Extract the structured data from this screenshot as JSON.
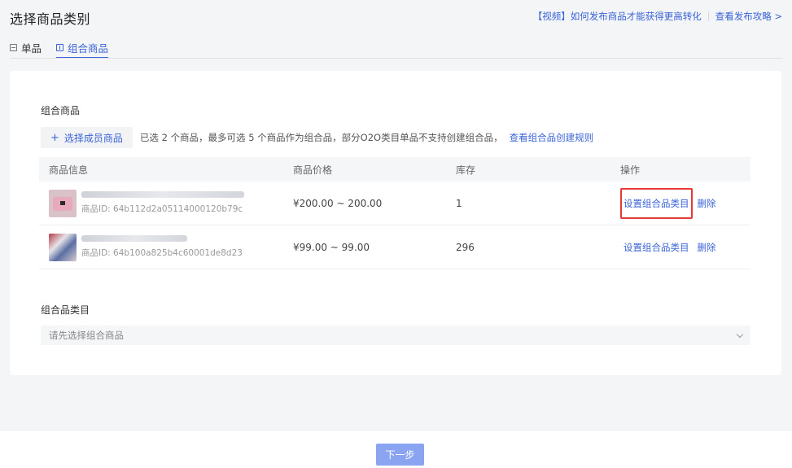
{
  "header": {
    "title": "选择商品类别",
    "link_video": "【视频】如何发布商品才能获得更高转化",
    "link_guide": "查看发布攻略 >",
    "tabs": [
      {
        "label": "单品",
        "active": false
      },
      {
        "label": "组合商品",
        "active": true
      }
    ]
  },
  "combo": {
    "section_title": "组合商品",
    "add_button": "选择成员商品",
    "hint": "已选 2 个商品，最多可选 5 个商品作为组合品，部分O2O类目单品不支持创建组合品，",
    "rule_link": "查看组合品创建规则",
    "table": {
      "headers": [
        "商品信息",
        "商品价格",
        "库存",
        "操作"
      ],
      "rows": [
        {
          "pid": "商品ID: 64b112d2a05114000120b79c",
          "price": "¥200.00 ~ 200.00",
          "stock": "1",
          "op_set": "设置组合品类目",
          "op_delete": "删除",
          "highlighted": true
        },
        {
          "pid": "商品ID: 64b100a825b4c60001de8d23",
          "price": "¥99.00 ~ 99.00",
          "stock": "296",
          "op_set": "设置组合品类目",
          "op_delete": "删除",
          "highlighted": false
        }
      ]
    }
  },
  "category": {
    "section_title": "组合品类目",
    "placeholder": "请先选择组合商品"
  },
  "footer": {
    "next_button": "下一步"
  },
  "colors": {
    "accent": "#3a63d6",
    "highlight_border": "#e53935",
    "next_button_bg": "#8aa4f2"
  }
}
